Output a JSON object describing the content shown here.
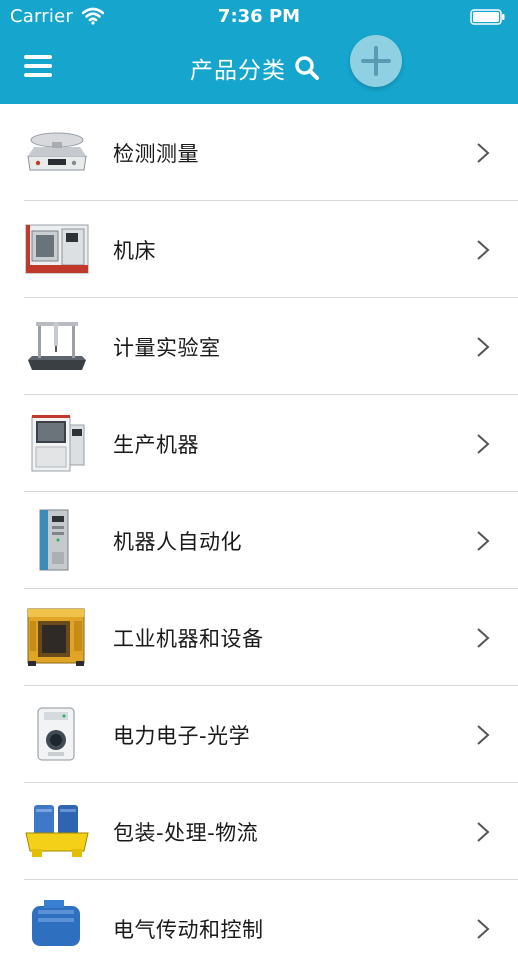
{
  "status_bar": {
    "carrier": "Carrier",
    "time": "7:36 PM"
  },
  "header": {
    "title": "产品分类",
    "menu_icon": "hamburger-menu-icon",
    "search_icon": "search-icon",
    "add_icon": "plus-icon",
    "color": "#16a5cd",
    "add_button_color": "#8fd1e3"
  },
  "categories": [
    {
      "label": "检测测量",
      "icon": "scale-thumbnail"
    },
    {
      "label": "机床",
      "icon": "machine-tool-thumbnail"
    },
    {
      "label": "计量实验室",
      "icon": "cmm-thumbnail"
    },
    {
      "label": "生产机器",
      "icon": "edm-machine-thumbnail"
    },
    {
      "label": "机器人自动化",
      "icon": "plc-module-thumbnail"
    },
    {
      "label": "工业机器和设备",
      "icon": "charger-cabinet-thumbnail"
    },
    {
      "label": "电力电子-光学",
      "icon": "socket-box-thumbnail"
    },
    {
      "label": "包装-处理-物流",
      "icon": "spill-pallet-thumbnail"
    },
    {
      "label": "电气传动和控制",
      "icon": "motor-thumbnail"
    }
  ]
}
